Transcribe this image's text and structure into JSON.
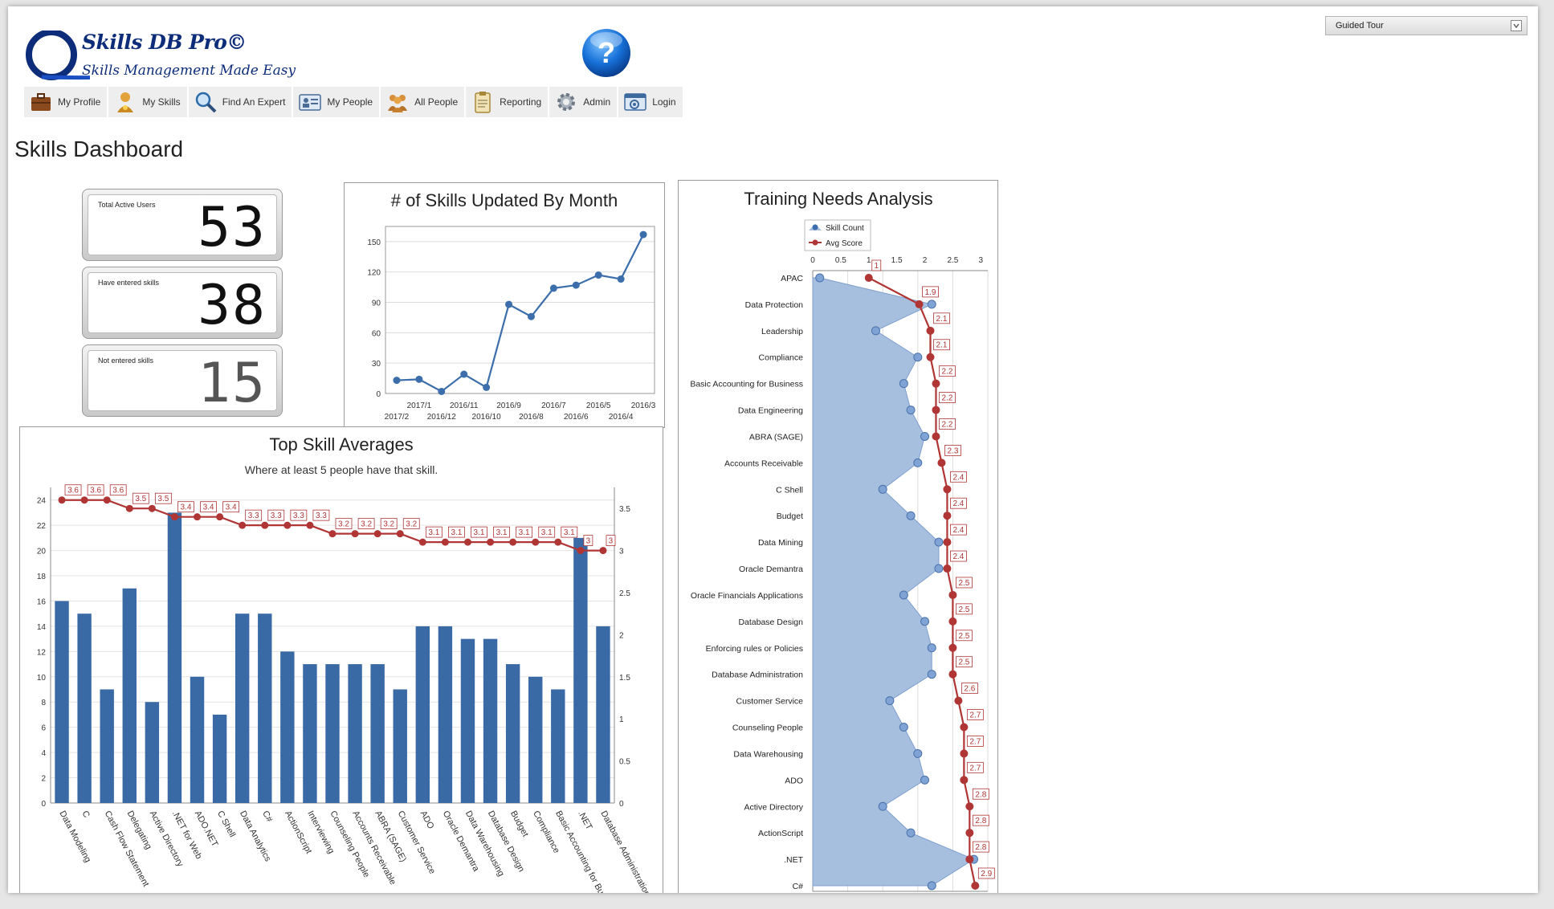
{
  "app": {
    "logo_title": "Skills DB Pro©",
    "logo_subtitle": "Skills Management Made Easy",
    "help_icon": "help-question-icon",
    "guided_tour": "Guided Tour"
  },
  "nav": [
    {
      "label": "My Profile",
      "icon": "briefcase-icon"
    },
    {
      "label": "My Skills",
      "icon": "award-person-icon"
    },
    {
      "label": "Find An Expert",
      "icon": "magnifier-icon"
    },
    {
      "label": "My People",
      "icon": "id-card-icon"
    },
    {
      "label": "All People",
      "icon": "people-group-icon"
    },
    {
      "label": "Reporting",
      "icon": "clipboard-icon"
    },
    {
      "label": "Admin",
      "icon": "gear-icon"
    },
    {
      "label": "Login",
      "icon": "login-window-icon"
    }
  ],
  "page_title": "Skills Dashboard",
  "kpis": [
    {
      "label": "Total Active Users",
      "value": "53"
    },
    {
      "label": "Have entered skills",
      "value": "38"
    },
    {
      "label": "Not entered skills",
      "value": "15"
    }
  ],
  "colors": {
    "bar": "#3a6aa6",
    "line_blue": "#3b6eab",
    "line_red": "#b03535",
    "area": "#a7bfdf"
  },
  "chart_data": [
    {
      "type": "line",
      "title": "# of Skills Updated By Month",
      "categories": [
        "2017/2",
        "2017/1",
        "2016/12",
        "2016/11",
        "2016/10",
        "2016/9",
        "2016/8",
        "2016/7",
        "2016/6",
        "2016/5",
        "2016/4",
        "2016/3"
      ],
      "values": [
        13,
        14,
        2,
        19,
        6,
        88,
        76,
        104,
        107,
        117,
        113,
        157
      ],
      "ylim": [
        0,
        165
      ],
      "yticks": [
        0,
        30,
        60,
        90,
        120,
        150
      ],
      "grid": true
    },
    {
      "type": "bar",
      "title": "Top Skill Averages",
      "subtitle": "Where at least 5 people have that skill.",
      "categories": [
        "Data Modeling",
        "C",
        "Cash Flow Statement",
        "Delegating",
        "Active Directory",
        ".NET for Web",
        "ADO.NET",
        "C Shell",
        "Data Analytics",
        "C#",
        "ActionScript",
        "Interviewing",
        "Counseling People",
        "Accounts Receivable",
        "ABRA (SAGE)",
        "Customer Service",
        "ADO",
        "Oracle Demantra",
        "Data Warehousing",
        "Database Design",
        "Budget",
        "Compliance",
        "Basic Accounting for Business",
        ".NET",
        "Database Administration"
      ],
      "series": [
        {
          "values": [
            16,
            15,
            9,
            17,
            8,
            23,
            10,
            7,
            15,
            15,
            12,
            11,
            11,
            11,
            11,
            9,
            14,
            14,
            13,
            13,
            11,
            10,
            9,
            21,
            14
          ]
        },
        {
          "values": [
            3.6,
            3.6,
            3.6,
            3.5,
            3.5,
            3.4,
            3.4,
            3.4,
            3.3,
            3.3,
            3.3,
            3.3,
            3.2,
            3.2,
            3.2,
            3.2,
            3.1,
            3.1,
            3.1,
            3.1,
            3.1,
            3.1,
            3.1,
            3,
            3
          ]
        }
      ],
      "ylim": [
        0,
        25
      ],
      "yticks": [
        0,
        2,
        4,
        6,
        8,
        10,
        12,
        14,
        16,
        18,
        20,
        22,
        24
      ],
      "y2lim": [
        0,
        3.75
      ],
      "y2ticks": [
        0,
        0.5,
        1,
        1.5,
        2,
        2.5,
        3,
        3.5
      ],
      "grid": true
    },
    {
      "type": "area",
      "title": "Training Needs Analysis",
      "legend": [
        "Skill Count",
        "Avg Score"
      ],
      "legend_position": "top",
      "categories": [
        "APAC",
        "Data Protection",
        "Leadership",
        "Compliance",
        "Basic Accounting for Business",
        "Data Engineering",
        "ABRA (SAGE)",
        "Accounts Receivable",
        "C Shell",
        "Budget",
        "Data Mining",
        "Oracle Demantra",
        "Oracle Financials Applications",
        "Database Design",
        "Enforcing rules or Policies",
        "Database Administration",
        "Customer Service",
        "Counseling People",
        "Data Warehousing",
        "ADO",
        "Active Directory",
        "ActionScript",
        ".NET",
        "C#"
      ],
      "series": [
        {
          "name": "Skill Count",
          "values": [
            1,
            17,
            9,
            15,
            13,
            14,
            16,
            15,
            10,
            14,
            18,
            18,
            13,
            16,
            17,
            17,
            11,
            13,
            15,
            16,
            10,
            14,
            23,
            17
          ]
        },
        {
          "name": "Avg Score",
          "values": [
            1,
            1.9,
            2.1,
            2.1,
            2.2,
            2.2,
            2.2,
            2.3,
            2.4,
            2.4,
            2.4,
            2.4,
            2.5,
            2.5,
            2.5,
            2.5,
            2.6,
            2.7,
            2.7,
            2.7,
            2.8,
            2.8,
            2.8,
            2.9
          ]
        }
      ],
      "xlim": [
        0,
        25
      ],
      "xticks": [
        0,
        5,
        10,
        15,
        20,
        25
      ],
      "x2lim": [
        0,
        3.125
      ],
      "x2ticks": [
        0,
        0.5,
        1,
        1.5,
        2,
        2.5,
        3
      ],
      "grid": true
    }
  ]
}
